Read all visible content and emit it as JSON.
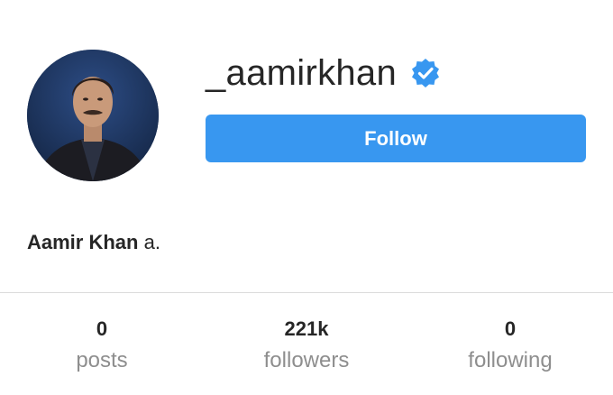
{
  "profile": {
    "username": "_aamirkhan",
    "verified": true,
    "verified_icon": "verified-badge-icon",
    "avatar_icon": "profile-photo",
    "follow_label": "Follow",
    "bio_name": "Aamir Khan",
    "bio_text": " a."
  },
  "stats": [
    {
      "value": "0",
      "label": "posts"
    },
    {
      "value": "221k",
      "label": "followers"
    },
    {
      "value": "0",
      "label": "following"
    }
  ],
  "colors": {
    "accent": "#3897f0",
    "verified": "#3897f0",
    "muted_text": "#8e8e8e",
    "divider": "#dbdbdb"
  }
}
